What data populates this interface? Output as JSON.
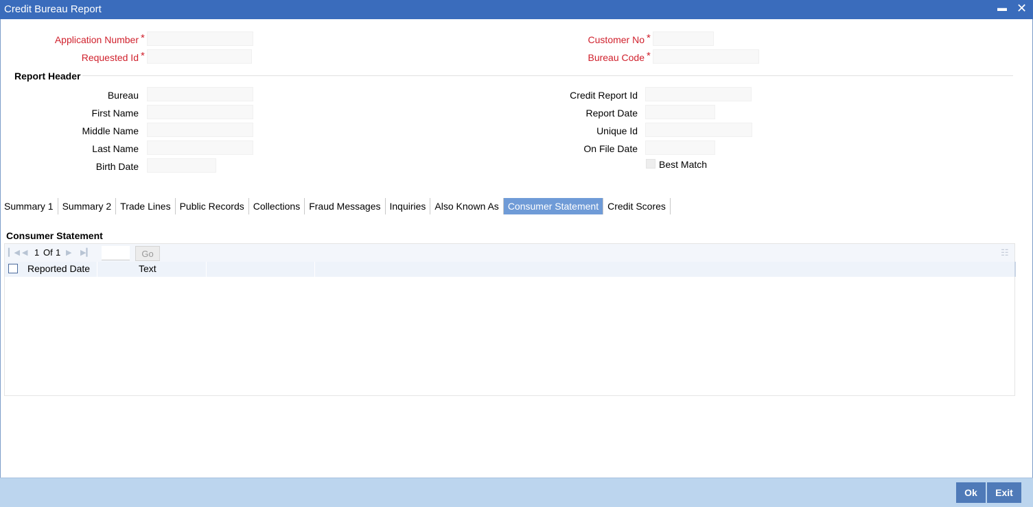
{
  "window": {
    "title": "Credit Bureau Report",
    "minimize": "▬",
    "close": "✕"
  },
  "form": {
    "application_number_label": "Application Number",
    "requested_id_label": "Requested Id",
    "customer_no_label": "Customer No",
    "bureau_code_label": "Bureau Code",
    "required_mark": "*"
  },
  "report_header": {
    "title": "Report Header",
    "bureau_label": "Bureau",
    "first_name_label": "First Name",
    "middle_name_label": "Middle Name",
    "last_name_label": "Last Name",
    "birth_date_label": "Birth Date",
    "credit_report_id_label": "Credit Report Id",
    "report_date_label": "Report Date",
    "unique_id_label": "Unique Id",
    "on_file_date_label": "On File Date",
    "best_match_label": "Best Match"
  },
  "tabs": [
    {
      "label": "Summary 1"
    },
    {
      "label": "Summary 2"
    },
    {
      "label": "Trade Lines"
    },
    {
      "label": "Public Records"
    },
    {
      "label": "Collections"
    },
    {
      "label": "Fraud Messages"
    },
    {
      "label": "Inquiries"
    },
    {
      "label": "Also Known As"
    },
    {
      "label": "Consumer Statement",
      "active": true
    },
    {
      "label": "Credit Scores"
    }
  ],
  "consumer_statement": {
    "title": "Consumer Statement",
    "pager": {
      "current": "1",
      "of_label": "Of",
      "total": "1",
      "go_label": "Go"
    },
    "columns": [
      "Reported Date",
      "Text"
    ]
  },
  "footer": {
    "ok_label": "Ok",
    "exit_label": "Exit"
  }
}
